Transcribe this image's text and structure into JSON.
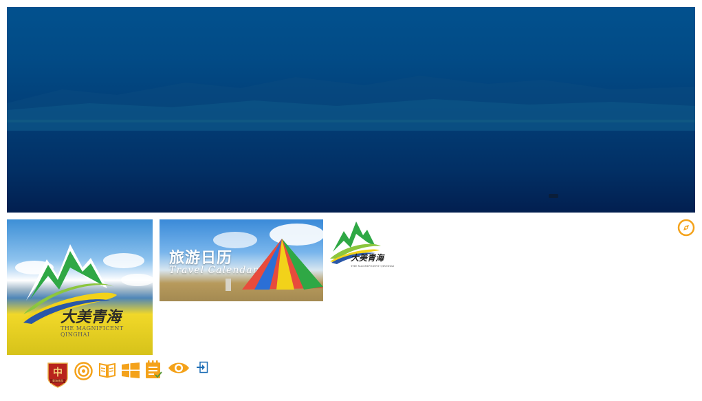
{
  "tiles": {
    "logo_tile": {
      "brand_cn": "大美青海",
      "brand_en": "THE MAGNIFICENT QINGHAI"
    },
    "calendar_tile": {
      "title": "旅游日历",
      "subtitle": "Travel Calendar"
    },
    "small_logo": {
      "brand_cn": "大美青海",
      "brand_en": "THE MAGNIFICENT QINGHAI"
    }
  },
  "toolbar": {
    "badge_text": "青海旅游",
    "icons": [
      "emblem-badge-icon",
      "target-icon",
      "book-icon",
      "windows-icon",
      "notes-icon",
      "eye-icon",
      "login-icon"
    ]
  },
  "colors": {
    "accent_orange": "#f4a21a",
    "hero_top": "#02518e",
    "hero_bottom": "#021f50",
    "badge_red": "#b8241c",
    "login_blue": "#1f6fb6"
  }
}
